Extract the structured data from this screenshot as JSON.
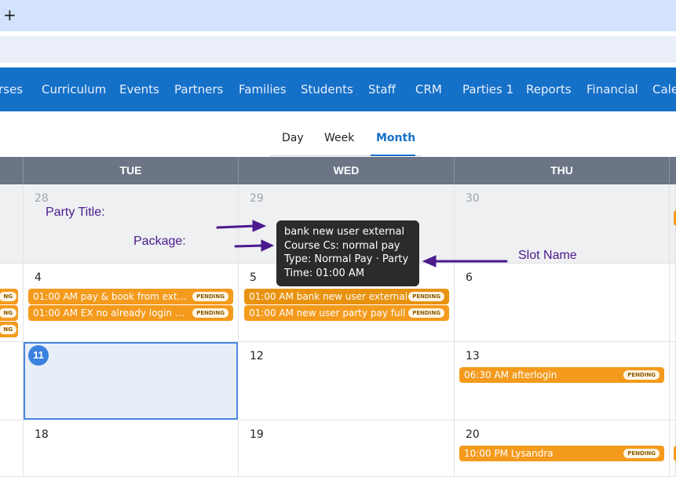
{
  "browser": {
    "new_tab_symbol": "+"
  },
  "nav": {
    "items": [
      "rses",
      "Curriculum",
      "Events",
      "Partners",
      "Families",
      "Students",
      "Staff",
      "CRM",
      "Parties 1",
      "Reports",
      "Financial",
      "Cale"
    ]
  },
  "view_tabs": {
    "day": "Day",
    "week": "Week",
    "month": "Month",
    "active": "Month"
  },
  "headers": [
    "TUE",
    "WED",
    "THU"
  ],
  "weeks": [
    {
      "days": [
        "28",
        "29",
        "30"
      ],
      "muted": true
    },
    {
      "days": [
        "4",
        "5",
        "6"
      ]
    },
    {
      "days": [
        "11",
        "12",
        "13"
      ],
      "today": "11"
    },
    {
      "days": [
        "18",
        "19",
        "20"
      ]
    }
  ],
  "events": {
    "tue4": [
      {
        "time_title": "01:00 AM pay & book from exter...",
        "status": "PENDING"
      },
      {
        "time_title": "01:00 AM EX no already login nor...",
        "status": "PENDING"
      }
    ],
    "wed5": [
      {
        "time_title": "01:00 AM bank new user external",
        "status": "PENDING"
      },
      {
        "time_title": "01:00 AM new user party pay full",
        "status": "PENDING"
      }
    ],
    "thu13": [
      {
        "time_title": "06:30 AM afterlogin",
        "status": "PENDING"
      }
    ],
    "thu20": [
      {
        "time_title": "10:00 PM Lysandra",
        "status": "PENDING"
      }
    ],
    "left_partial": [
      "NG",
      "NG",
      "NG"
    ]
  },
  "tooltip": {
    "line1": "bank new user external",
    "line2": "Course Cs: normal pay",
    "line3": "Type: Normal Pay · Party",
    "line4": "Time: 01:00 AM"
  },
  "annotations": {
    "party_title": "Party Title:",
    "package": "Package:",
    "slot_name": "Slot Name"
  },
  "colors": {
    "nav_bg": "#1570c8",
    "header_bg": "#6c7585",
    "event_bg": "#f49a1c",
    "annotation": "#4b1a8c",
    "today_badge": "#3b82e0"
  }
}
